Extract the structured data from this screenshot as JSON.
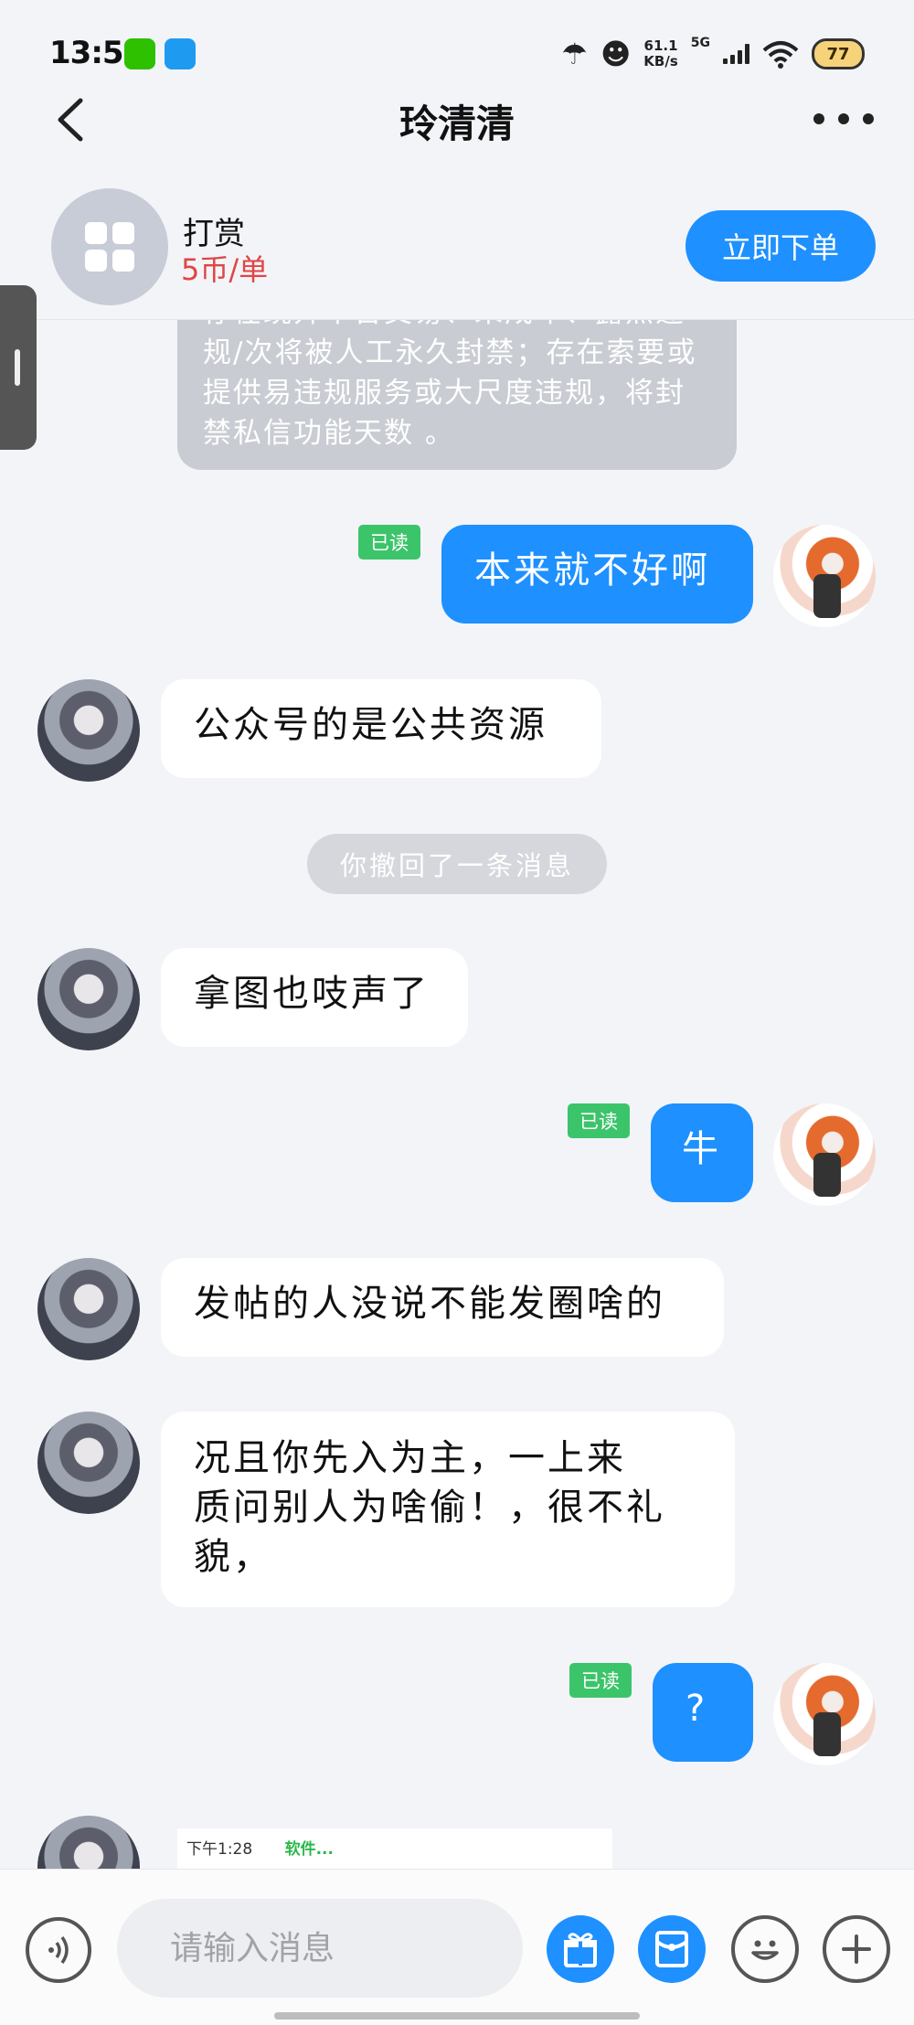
{
  "status_bar": {
    "time": "13:56",
    "net_speed_top": "61.1",
    "net_speed_bottom": "KB/s",
    "network_type": "5G",
    "battery": "77",
    "apps": [
      "wechat-icon",
      "qq-icon"
    ]
  },
  "nav": {
    "title": "玲清清"
  },
  "tip": {
    "title": "打赏",
    "price": "5币/单",
    "order_button": "立即下单"
  },
  "messages": {
    "system_notice": "存在绕开平台交易、未成年、露点违规/次将被人工永久封禁；存在索要或提供易违规服务或大尺度违规，将封禁私信功能天数 。",
    "m1": {
      "text": "本来就不好啊",
      "read": "已读"
    },
    "m2": {
      "text": "公众号的是公共资源"
    },
    "recall": "你撤回了一条消息",
    "m3": {
      "text": "拿图也吱声了"
    },
    "m4": {
      "text": "牛",
      "read": "已读"
    },
    "m5": {
      "text": "发帖的人没说不能发圈啥的"
    },
    "m6": {
      "line1": "况且你先入为主，一上来",
      "line2": "质问别人为啥偷！，很不礼",
      "line3": "貌，"
    },
    "m7": {
      "text": "?",
      "read": "已读"
    },
    "image_preview": {
      "time": "下午1:28",
      "text": "软件..."
    }
  },
  "input": {
    "placeholder": "请输入消息"
  },
  "colors": {
    "accent": "#1e90ff",
    "read_badge": "#3cc46a",
    "price": "#e14545",
    "background": "#f2f4f8"
  }
}
